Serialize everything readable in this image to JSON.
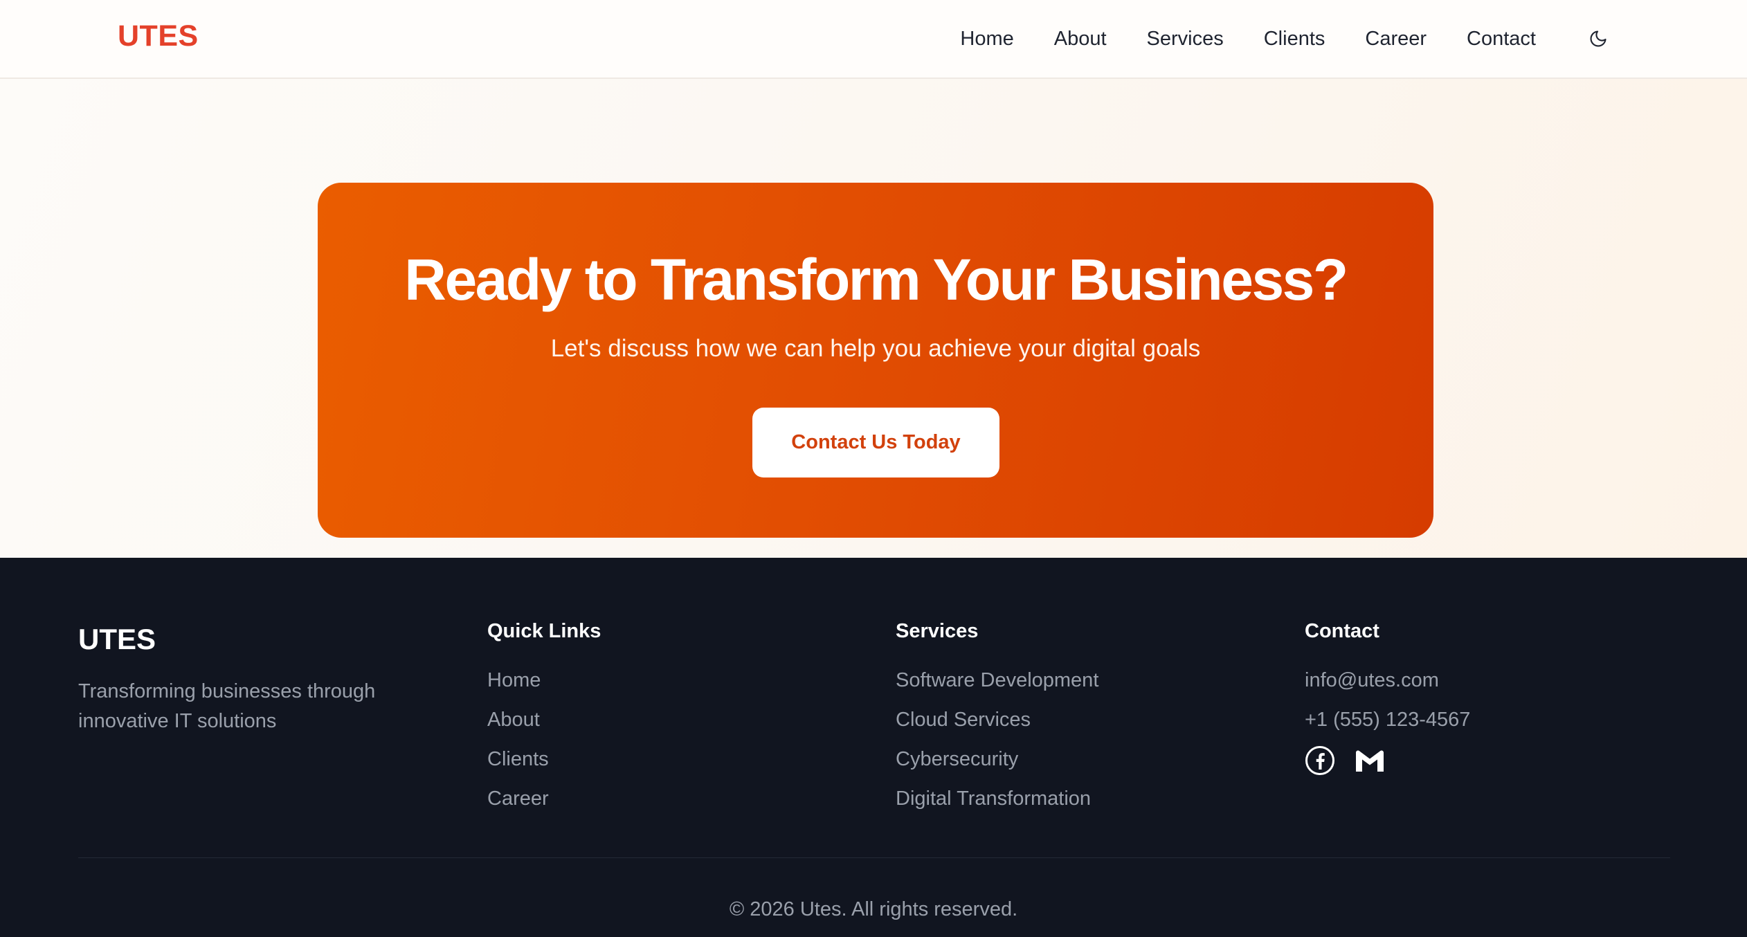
{
  "header": {
    "logo": "UTES",
    "nav": [
      {
        "label": "Home"
      },
      {
        "label": "About"
      },
      {
        "label": "Services"
      },
      {
        "label": "Clients"
      },
      {
        "label": "Career"
      },
      {
        "label": "Contact"
      }
    ],
    "theme_toggle_icon": "moon-icon"
  },
  "cta": {
    "title": "Ready to Transform Your Business?",
    "subtitle": "Let's discuss how we can help you achieve your digital goals",
    "button_label": "Contact Us Today"
  },
  "footer": {
    "brand": "UTES",
    "tagline": "Transforming businesses through innovative IT solutions",
    "quick_links": {
      "heading": "Quick Links",
      "items": [
        "Home",
        "About",
        "Clients",
        "Career"
      ]
    },
    "services": {
      "heading": "Services",
      "items": [
        "Software Development",
        "Cloud Services",
        "Cybersecurity",
        "Digital Transformation"
      ]
    },
    "contact": {
      "heading": "Contact",
      "email": "info@utes.com",
      "phone": "+1 (555) 123-4567",
      "social_icons": [
        "facebook-icon",
        "gmail-icon"
      ]
    },
    "copyright": "© 2026 Utes. All rights reserved."
  },
  "colors": {
    "brand": "#e4412a",
    "cta_gradient_start": "#ea5d00",
    "cta_gradient_end": "#d63c00",
    "footer_bg": "#111520",
    "footer_text": "#9aa0ab"
  }
}
